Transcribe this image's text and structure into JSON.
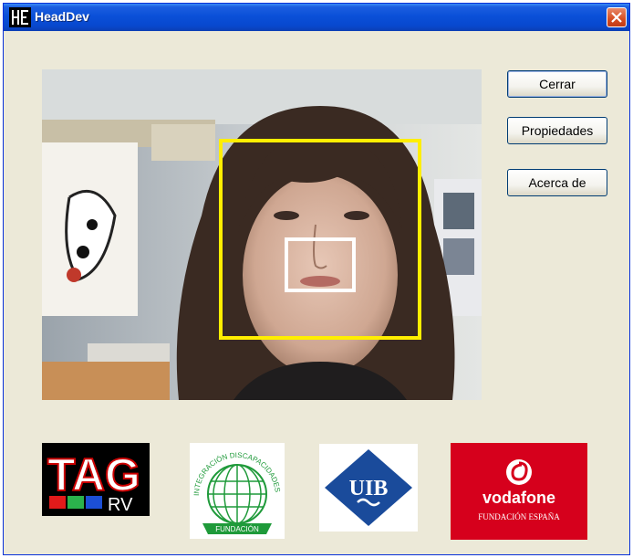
{
  "window": {
    "title": "HeadDev"
  },
  "buttons": {
    "close": "Cerrar",
    "properties": "Propiedades",
    "about": "Acerca de"
  },
  "logos": {
    "tagrv": {
      "text_main": "TAG",
      "text_sub": "RV"
    },
    "fundacion_red": {
      "arc_top": "INTEGRACIÓN DISCAPACIDADES RED",
      "ribbon": "FUNDACIÓN"
    },
    "uib": {
      "text": "UIB"
    },
    "vodafone": {
      "name": "vodafone",
      "sub": "FUNDACIÓN ESPAÑA"
    }
  },
  "colors": {
    "title_bar": "#0a50d8",
    "window_bg": "#ece9d8",
    "face_box": "#ffee00",
    "mouth_box": "#ffffff",
    "vodafone_red": "#d6001c",
    "uib_blue": "#1a4b9b",
    "fundacion_green": "#1f9a3a"
  },
  "icons": {
    "app": "he-logo-icon",
    "close": "close-x-icon"
  }
}
